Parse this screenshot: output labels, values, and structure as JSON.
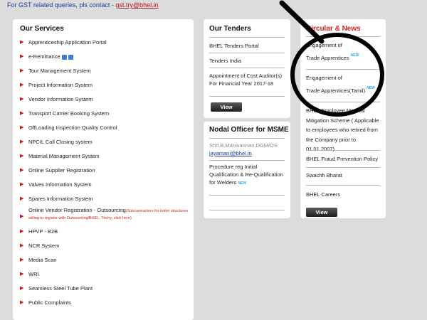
{
  "topbar": {
    "prefix": "For GST related queries, pls contact -",
    "email": "gst.try@bhel.in"
  },
  "services": {
    "title": "Our Services",
    "items": [
      {
        "label": "Apprenticeship Application Portal"
      },
      {
        "label": "e-Remittance"
      },
      {
        "label": "Tour Management System"
      },
      {
        "label": "Project Information System"
      },
      {
        "label": "Vendor Information System"
      },
      {
        "label": "Transport Carrier Booking System"
      },
      {
        "label": "OffLoading Inspection Quality Control"
      },
      {
        "label": "NPCIL Call Closing system"
      },
      {
        "label": "Material Management System"
      },
      {
        "label": "Online Supplier Registration"
      },
      {
        "label": "Valves Information System"
      },
      {
        "label": "Spares Information System"
      },
      {
        "label": "Online Vendor Registration - Outsourcing",
        "note": "(Subcontractors for boiler structures willing to register with Outsourcing/BHEL, Trichy, click here)"
      },
      {
        "label": "HPVP - B2B"
      },
      {
        "label": "NCR System"
      },
      {
        "label": "Media Scan"
      },
      {
        "label": "WRI"
      },
      {
        "label": "Seamless Steel Tube Plant"
      },
      {
        "label": "Public Complaints"
      }
    ]
  },
  "tenders": {
    "title": "Our Tenders",
    "items": [
      "BHEL Tenders Portal",
      "Tenders India",
      "Appointment of Cost Auditor(s) For Financial Year 2017-18"
    ],
    "view_label": "View"
  },
  "nodal": {
    "title": "Nodal Officer for MSME",
    "name": "Shri.B.Manivannan,DGM/OS",
    "email": "jayamani@bhel.in",
    "procedure": "Procedure reg Initial Qualification & Re-Qualification for Welders",
    "new_badge": "NEW"
  },
  "news": {
    "title": "Circular & News",
    "items": [
      {
        "line1": "Engagement of",
        "line2": "Trade Apprentices",
        "badge": "NEW"
      },
      {
        "line1": "Engagement of",
        "line2": "Trade Apprentices(Tamil)",
        "badge": "NEW"
      },
      {
        "text": "BHEL Employee Medical Mitigation Scheme ( Applicable to employees who retired from the Company prior to 01.01.2007)"
      },
      {
        "text": "BHEL Fraud Prevention Policy"
      },
      {
        "text": "Swachh Bharat"
      },
      {
        "text": "BHEL Careers"
      }
    ],
    "view_label": "View"
  },
  "colors": {
    "background": "#dcdcdc",
    "panel": "#ffffff",
    "accent_red": "#d11d1d",
    "link_blue": "#1b3a9a",
    "button": "#2a2a2a",
    "annotation": "#000000"
  }
}
